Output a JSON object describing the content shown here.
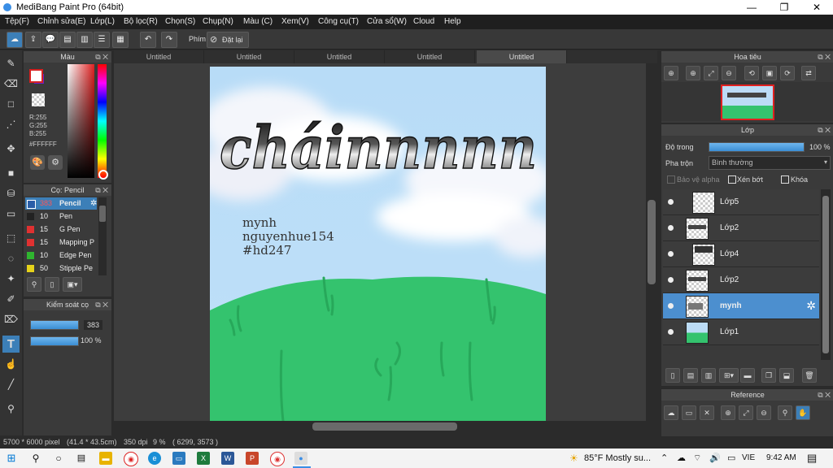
{
  "window": {
    "title": "MediBang Paint Pro (64bit)",
    "controls": {
      "minimize": "—",
      "maximize": "❐",
      "close": "✕"
    }
  },
  "menu": [
    "Tệp(F)",
    "Chỉnh sửa(E)",
    "Lớp(L)",
    "Bộ lọc(R)",
    "Chọn(S)",
    "Chụp(N)",
    "Màu (C)",
    "Xem(V)",
    "Công cụ(T)",
    "Cửa sổ(W)",
    "Cloud",
    "Help"
  ],
  "toolbar": {
    "shortcut_label": "Phím",
    "reset_label": "Đặt lại"
  },
  "color_panel": {
    "title": "Màu",
    "r": "R:255",
    "g": "G:255",
    "b": "B:255",
    "hex": "#FFFFFF",
    "primary": "#ffffff",
    "secondary": "#6a1fc9"
  },
  "pencil_panel": {
    "title": "Cọ: Pencil",
    "brushes": [
      {
        "size": "383",
        "name": "Pencil",
        "color": "#2a5ea8",
        "selected": true
      },
      {
        "size": "10",
        "name": "Pen",
        "color": "#222222"
      },
      {
        "size": "15",
        "name": "G Pen",
        "color": "#e03131"
      },
      {
        "size": "15",
        "name": "Mapping P",
        "color": "#e03131"
      },
      {
        "size": "10",
        "name": "Edge Pen",
        "color": "#2fb52f"
      },
      {
        "size": "50",
        "name": "Stipple Pe",
        "color": "#e6d21a"
      }
    ]
  },
  "kiem_panel": {
    "title": "Kiểm soát cọ",
    "size": "383",
    "opacity": "100 %"
  },
  "tabs": [
    "Untitled",
    "Untitled",
    "Untitled",
    "Untitled",
    "Untitled"
  ],
  "canvas": {
    "lettering": "cháinnnnn",
    "text_lines": [
      "mynh",
      "nguyenhue154",
      "#hd247"
    ]
  },
  "status": {
    "size": "5700 * 6000 pixel",
    "cm": "(41.4 * 43.5cm)",
    "dpi": "350 dpi",
    "zoom": "9 %",
    "coords": "( 6299, 3573 )"
  },
  "nav_panel": {
    "title": "Hoa tiêu"
  },
  "layer_panel": {
    "title": "Lớp",
    "opacity_label": "Độ trong",
    "opacity_value": "100 %",
    "blend_label": "Pha trộn",
    "blend_value": "Bình thường",
    "protect_alpha": "Bảo vệ alpha",
    "clipping": "Xén bớt",
    "lock": "Khóa",
    "layers": [
      {
        "name": "Lớp5"
      },
      {
        "name": "Lớp2"
      },
      {
        "name": "Lớp4"
      },
      {
        "name": "Lớp2"
      },
      {
        "name": "mynh",
        "selected": true
      },
      {
        "name": "Lớp1"
      }
    ]
  },
  "ref_panel": {
    "title": "Reference"
  },
  "taskbar": {
    "weather": "85°F  Mostly su...",
    "lang": "VIE",
    "time": "9:42 AM"
  }
}
